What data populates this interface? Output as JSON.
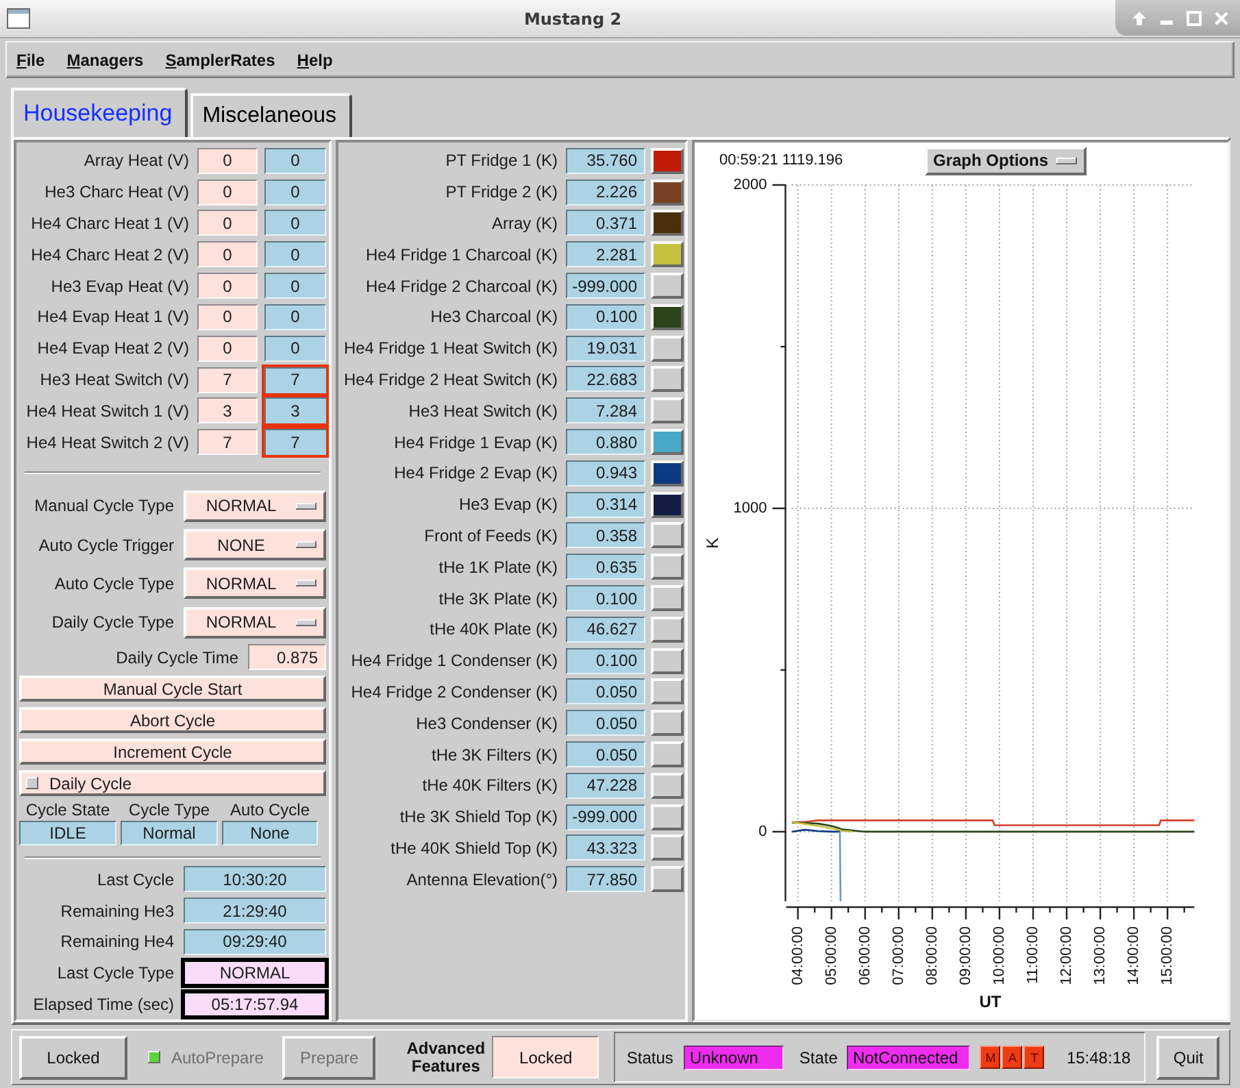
{
  "window": {
    "title": "Mustang 2"
  },
  "menu": [
    "File",
    "Managers",
    "SamplerRates",
    "Help"
  ],
  "tabs": [
    {
      "label": "Housekeeping",
      "selected": true
    },
    {
      "label": "Miscelaneous",
      "selected": false
    }
  ],
  "heaters": [
    {
      "label": "Array Heat (V)",
      "setpoint": "0",
      "reading": "0",
      "flagged": false
    },
    {
      "label": "He3 Charc Heat (V)",
      "setpoint": "0",
      "reading": "0",
      "flagged": false
    },
    {
      "label": "He4 Charc Heat 1 (V)",
      "setpoint": "0",
      "reading": "0",
      "flagged": false
    },
    {
      "label": "He4 Charc Heat 2 (V)",
      "setpoint": "0",
      "reading": "0",
      "flagged": false
    },
    {
      "label": "He3 Evap Heat (V)",
      "setpoint": "0",
      "reading": "0",
      "flagged": false
    },
    {
      "label": "He4 Evap Heat 1 (V)",
      "setpoint": "0",
      "reading": "0",
      "flagged": false
    },
    {
      "label": "He4 Evap Heat 2 (V)",
      "setpoint": "0",
      "reading": "0",
      "flagged": false
    },
    {
      "label": "He3 Heat Switch (V)",
      "setpoint": "7",
      "reading": "7",
      "flagged": true
    },
    {
      "label": "He4 Heat Switch 1 (V)",
      "setpoint": "3",
      "reading": "3",
      "flagged": true
    },
    {
      "label": "He4 Heat Switch 2 (V)",
      "setpoint": "7",
      "reading": "7",
      "flagged": true
    }
  ],
  "cycle_settings": [
    {
      "label": "Manual Cycle Type",
      "value": "NORMAL"
    },
    {
      "label": "Auto Cycle Trigger",
      "value": "NONE"
    },
    {
      "label": "Auto Cycle Type",
      "value": "NORMAL"
    },
    {
      "label": "Daily Cycle Type",
      "value": "NORMAL"
    }
  ],
  "daily_cycle_time": {
    "label": "Daily Cycle Time",
    "value": "0.875"
  },
  "cycle_buttons": [
    "Manual Cycle Start",
    "Abort Cycle",
    "Increment Cycle"
  ],
  "daily_cycle": {
    "label": "Daily Cycle",
    "checked": false
  },
  "cycle_status": [
    {
      "label": "Cycle State",
      "value": "IDLE"
    },
    {
      "label": "Cycle Type",
      "value": "Normal"
    },
    {
      "label": "Auto Cycle",
      "value": "None"
    }
  ],
  "cycle_times": [
    {
      "label": "Last Cycle",
      "value": "10:30:20",
      "kind": "readout"
    },
    {
      "label": "Remaining He3",
      "value": "21:29:40",
      "kind": "readout"
    },
    {
      "label": "Remaining He4",
      "value": "09:29:40",
      "kind": "readout"
    },
    {
      "label": "Last Cycle Type",
      "value": "NORMAL",
      "kind": "highlighted"
    },
    {
      "label": "Elapsed Time (sec)",
      "value": "05:17:57.94",
      "kind": "highlighted"
    }
  ],
  "sensors": [
    {
      "label": "PT Fridge 1 (K)",
      "value": "35.760",
      "color": "#c01c08"
    },
    {
      "label": "PT Fridge 2 (K)",
      "value": "2.226",
      "color": "#7a4224"
    },
    {
      "label": "Array (K)",
      "value": "0.371",
      "color": "#48300a"
    },
    {
      "label": "He4 Fridge 1 Charcoal (K)",
      "value": "2.281",
      "color": "#c4c23e"
    },
    {
      "label": "He4 Fridge 2 Charcoal (K)",
      "value": "-999.000"
    },
    {
      "label": "He3 Charcoal (K)",
      "value": "0.100",
      "color": "#2c441c"
    },
    {
      "label": "He4 Fridge 1 Heat Switch (K)",
      "value": "19.031"
    },
    {
      "label": "He4 Fridge 2 Heat Switch (K)",
      "value": "22.683"
    },
    {
      "label": "He3 Heat Switch (K)",
      "value": "7.284"
    },
    {
      "label": "He4 Fridge 1 Evap (K)",
      "value": "0.880",
      "color": "#4aa8c8"
    },
    {
      "label": "He4 Fridge 2 Evap (K)",
      "value": "0.943",
      "color": "#0c3a82"
    },
    {
      "label": "He3 Evap (K)",
      "value": "0.314",
      "color": "#141c44"
    },
    {
      "label": "Front of Feeds (K)",
      "value": "0.358"
    },
    {
      "label": "tHe 1K Plate (K)",
      "value": "0.635"
    },
    {
      "label": "tHe 3K Plate (K)",
      "value": "0.100"
    },
    {
      "label": "tHe 40K Plate (K)",
      "value": "46.627"
    },
    {
      "label": "He4 Fridge 1 Condenser (K)",
      "value": "0.100"
    },
    {
      "label": "He4 Fridge 2 Condenser (K)",
      "value": "0.050"
    },
    {
      "label": "He3 Condenser (K)",
      "value": "0.050"
    },
    {
      "label": "tHe 3K Filters (K)",
      "value": "0.050"
    },
    {
      "label": "tHe 40K Filters (K)",
      "value": "47.228"
    },
    {
      "label": "tHe 3K Shield Top (K)",
      "value": "-999.000"
    },
    {
      "label": "tHe 40K Shield Top (K)",
      "value": "43.323"
    },
    {
      "label": "Antenna Elevation(°)",
      "value": "77.850"
    }
  ],
  "graph": {
    "readout": "00:59:21 1119.196",
    "options_label": "Graph Options",
    "chart_data": {
      "type": "line",
      "xlabel": "UT",
      "ylabel": "K",
      "grid": true,
      "x": [
        3.82,
        4.2,
        4.6,
        5.0,
        5.25,
        5.27,
        5.6,
        6.0,
        9.8,
        9.85,
        14.75,
        14.8,
        15.8
      ],
      "series": [
        {
          "color": "#d8402c",
          "values": [
            30,
            30,
            35,
            35,
            35,
            35,
            35,
            35,
            35,
            20,
            20,
            35,
            35
          ]
        },
        {
          "color": "#2c441c",
          "values": [
            28,
            27,
            25,
            18,
            10,
            8,
            4,
            0,
            0,
            0,
            0,
            0,
            0
          ]
        },
        {
          "color": "#c4c23e",
          "values": [
            30,
            24,
            18,
            10,
            5,
            3,
            0,
            null,
            null,
            null,
            null,
            null,
            null
          ]
        },
        {
          "color": "#0c3a82",
          "values": [
            0,
            6,
            2,
            0,
            0,
            null,
            null,
            null,
            null,
            null,
            null,
            null,
            null
          ]
        },
        {
          "color": "#6a96d0",
          "values": [
            null,
            null,
            null,
            null,
            0,
            -215,
            null,
            null,
            null,
            null,
            null,
            null,
            null
          ]
        }
      ],
      "xlim": [
        3.65,
        15.8
      ],
      "ylim": [
        -215,
        2000
      ],
      "xticks": [
        {
          "value": 4,
          "label": "04:00:00"
        },
        {
          "value": 5,
          "label": "05:00:00"
        },
        {
          "value": 6,
          "label": "06:00:00"
        },
        {
          "value": 7,
          "label": "07:00:00"
        },
        {
          "value": 8,
          "label": "08:00:00"
        },
        {
          "value": 9,
          "label": "09:00:00"
        },
        {
          "value": 10,
          "label": "10:00:00"
        },
        {
          "value": 11,
          "label": "11:00:00"
        },
        {
          "value": 12,
          "label": "12:00:00"
        },
        {
          "value": 13,
          "label": "13:00:00"
        },
        {
          "value": 14,
          "label": "14:00:00"
        },
        {
          "value": 15,
          "label": "15:00:00"
        }
      ],
      "yticks": [
        0,
        1000,
        2000
      ]
    }
  },
  "footer": {
    "lock_button": "Locked",
    "auto_prepare": {
      "label": "AutoPrepare",
      "checked": true,
      "disabled": true
    },
    "prepare_button": {
      "label": "Prepare",
      "disabled": true
    },
    "advanced_features": {
      "label": "Advanced Features",
      "value": "Locked"
    },
    "status": {
      "label": "Status",
      "value": "Unknown"
    },
    "state": {
      "label": "State",
      "value": "NotConnected"
    },
    "indicators": [
      "M",
      "A",
      "T"
    ],
    "clock": "15:48:18",
    "quit_button": "Quit"
  }
}
